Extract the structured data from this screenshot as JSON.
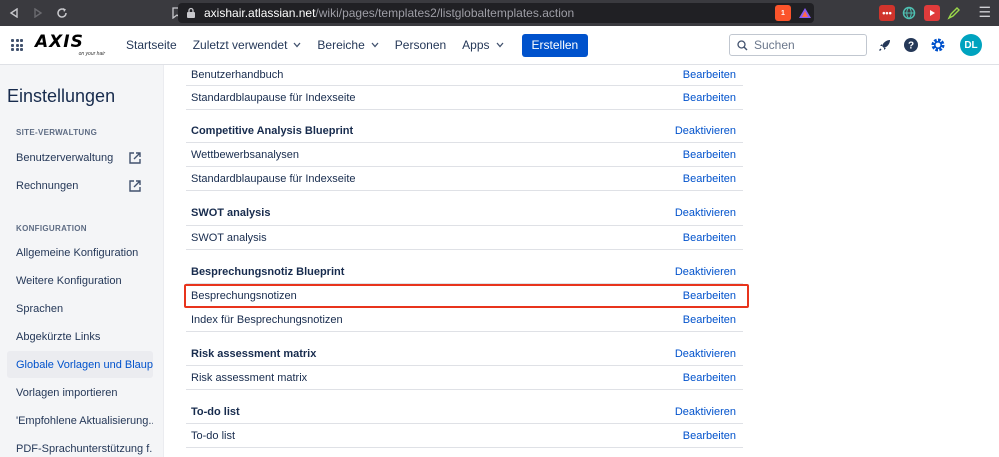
{
  "browser": {
    "url_domain": "axishair.atlassian.net",
    "url_path": "/wiki/pages/templates2/listglobaltemplates.action",
    "brave_badge": "1"
  },
  "header": {
    "logo_text": "AXIS",
    "logo_tagline": "on your hair",
    "nav": [
      {
        "label": "Startseite",
        "has_dropdown": false
      },
      {
        "label": "Zuletzt verwendet",
        "has_dropdown": true
      },
      {
        "label": "Bereiche",
        "has_dropdown": true
      },
      {
        "label": "Personen",
        "has_dropdown": false
      },
      {
        "label": "Apps",
        "has_dropdown": true
      }
    ],
    "create_label": "Erstellen",
    "search_placeholder": "Suchen",
    "avatar_initials": "DL",
    "accent_color": "#0052cc"
  },
  "sidebar": {
    "title": "Einstellungen",
    "sections": [
      {
        "label": "SITE-VERWALTUNG",
        "items": [
          {
            "label": "Benutzerverwaltung",
            "external": true
          },
          {
            "label": "Rechnungen",
            "external": true
          }
        ]
      },
      {
        "label": "KONFIGURATION",
        "items": [
          {
            "label": "Allgemeine Konfiguration"
          },
          {
            "label": "Weitere Konfiguration"
          },
          {
            "label": "Sprachen"
          },
          {
            "label": "Abgekürzte Links"
          },
          {
            "label": "Globale Vorlagen und Blaup...",
            "active": true
          },
          {
            "label": "Vorlagen importieren"
          },
          {
            "label": "'Empfohlene Aktualisierung..."
          },
          {
            "label": "PDF-Sprachunterstützung f..."
          }
        ]
      }
    ]
  },
  "table": {
    "rows": [
      {
        "type": "item",
        "name": "Benutzerhandbuch",
        "action": "Bearbeiten"
      },
      {
        "type": "item",
        "name": "Standardblaupause für Indexseite",
        "action": "Bearbeiten"
      },
      {
        "type": "header",
        "name": "Competitive Analysis Blueprint",
        "action": "Deaktivieren"
      },
      {
        "type": "item",
        "name": "Wettbewerbsanalysen",
        "action": "Bearbeiten"
      },
      {
        "type": "item",
        "name": "Standardblaupause für Indexseite",
        "action": "Bearbeiten"
      },
      {
        "type": "header",
        "name": "SWOT analysis",
        "action": "Deaktivieren"
      },
      {
        "type": "item",
        "name": "SWOT analysis",
        "action": "Bearbeiten"
      },
      {
        "type": "header",
        "name": "Besprechungsnotiz Blueprint",
        "action": "Deaktivieren"
      },
      {
        "type": "item",
        "name": "Besprechungsnotizen",
        "action": "Bearbeiten",
        "highlighted": true
      },
      {
        "type": "item",
        "name": "Index für Besprechungsnotizen",
        "action": "Bearbeiten"
      },
      {
        "type": "header",
        "name": "Risk assessment matrix",
        "action": "Deaktivieren"
      },
      {
        "type": "item",
        "name": "Risk assessment matrix",
        "action": "Bearbeiten"
      },
      {
        "type": "header",
        "name": "To-do list",
        "action": "Deaktivieren"
      },
      {
        "type": "item",
        "name": "To-do list",
        "action": "Bearbeiten"
      }
    ],
    "highlight_color": "#e8341c"
  }
}
